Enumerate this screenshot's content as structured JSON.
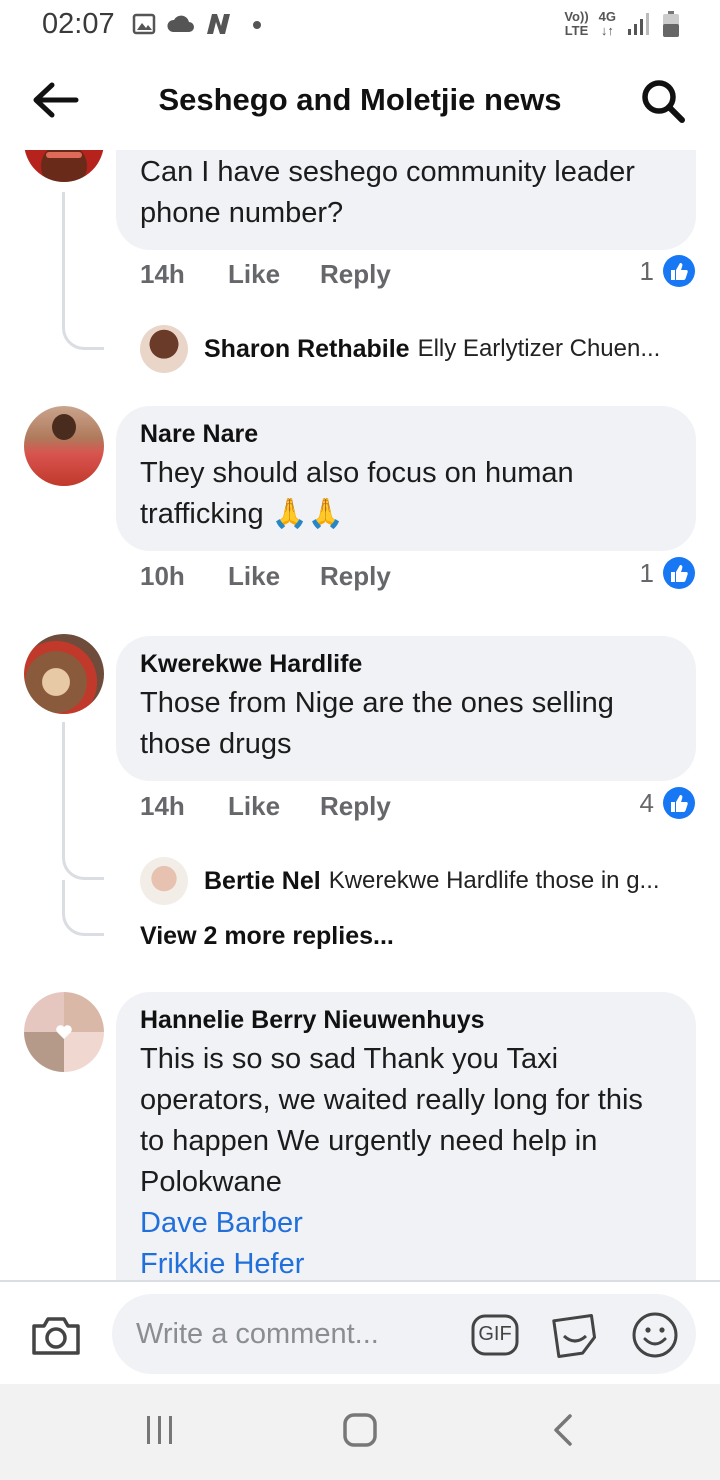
{
  "status_bar": {
    "time": "02:07",
    "network_top": "Vo))",
    "network_bottom": "LTE",
    "data_top": "4G",
    "data_bottom": "↓↑",
    "icons": [
      "image-icon",
      "cloud-icon",
      "n-app-icon",
      "dot-icon",
      "signal-icon",
      "battery-icon"
    ]
  },
  "header": {
    "title": "Seshego and Moletjie news",
    "icons": [
      "back-arrow-icon",
      "search-icon"
    ]
  },
  "comments": [
    {
      "author": "",
      "text": "Can I have seshego community leader phone number?",
      "age": "14h",
      "like_label": "Like",
      "reply_label": "Reply",
      "reaction_count": "1",
      "replies": [
        {
          "author": "Sharon  Rethabile",
          "text": "Elly Earlytizer Chuen..."
        }
      ]
    },
    {
      "author": "Nare Nare",
      "text": "They should also focus on human trafficking 🙏🙏",
      "age": "10h",
      "like_label": "Like",
      "reply_label": "Reply",
      "reaction_count": "1"
    },
    {
      "author": "Kwerekwe Hardlife",
      "text": "Those from Nige are the ones selling those drugs",
      "age": "14h",
      "like_label": "Like",
      "reply_label": "Reply",
      "reaction_count": "4",
      "replies": [
        {
          "author": "Bertie Nel",
          "text": "Kwerekwe Hardlife those in g..."
        }
      ],
      "more_replies": "View 2 more replies..."
    },
    {
      "author": "Hannelie Berry Nieuwenhuys",
      "text": "This is so so sad Thank you Taxi operators, we waited really long for this to happen We urgently need help in Polokwane",
      "mentions": [
        "Dave Barber",
        "Frikkie Hefer"
      ]
    }
  ],
  "composer": {
    "placeholder": "Write a comment...",
    "gif_label": "GIF",
    "icons": [
      "camera-icon",
      "gif-icon",
      "sticker-icon",
      "emoji-icon"
    ]
  },
  "nav_bar": {
    "icons": [
      "recent-apps-icon",
      "home-icon",
      "back-icon"
    ]
  },
  "colors": {
    "bubble": "#f0f2f5",
    "link": "#216fdb",
    "like_blue": "#1877f2",
    "meta_gray": "#65676b"
  }
}
